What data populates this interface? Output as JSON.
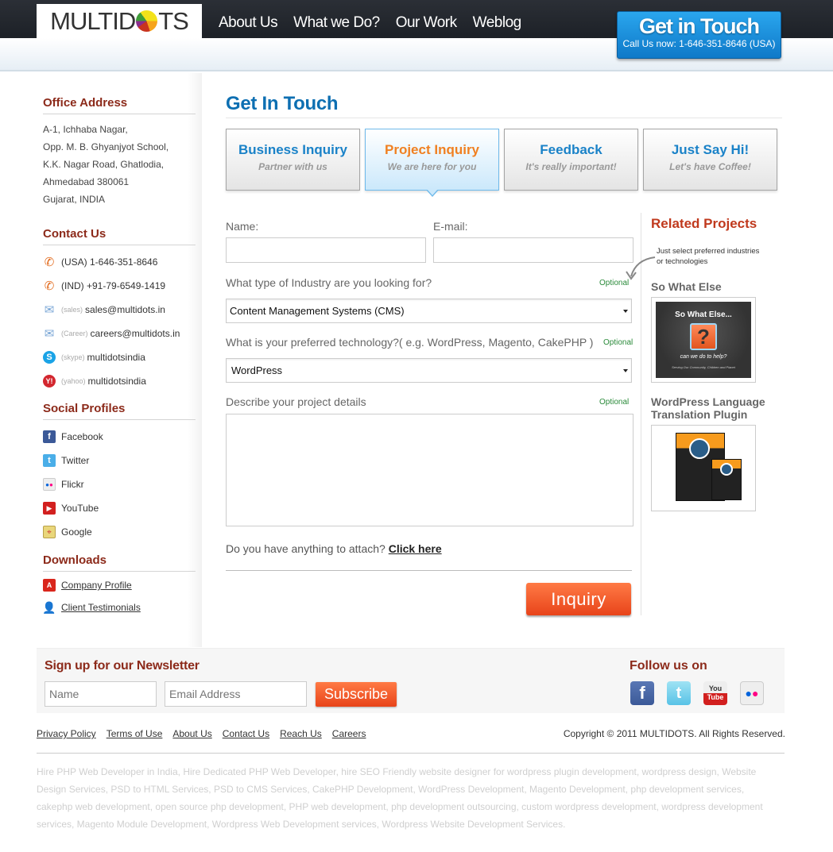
{
  "header": {
    "logo_text_left": "MULTID",
    "logo_text_right": "TS",
    "nav": [
      "About Us",
      "What we Do?",
      "Our Work",
      "Weblog"
    ],
    "cta_title": "Get in Touch",
    "cta_sub": "Call Us now: 1-646-351-8646 (USA)"
  },
  "sidebar": {
    "office": {
      "title": "Office Address",
      "lines": [
        "A-1, Ichhaba Nagar,",
        "Opp. M. B. Ghyanjyot School,",
        "K.K. Nagar Road, Ghatlodia,",
        "Ahmedabad 380061",
        "Gujarat, INDIA"
      ]
    },
    "contact": {
      "title": "Contact Us",
      "items": [
        {
          "icon": "phone-icon",
          "tag": "",
          "text": "(USA) 1-646-351-8646"
        },
        {
          "icon": "phone-icon",
          "tag": "",
          "text": "(IND) +91-79-6549-1419"
        },
        {
          "icon": "mail-icon",
          "tag": "(sales)",
          "text": "sales@multidots.in"
        },
        {
          "icon": "mail-icon",
          "tag": "(Career)",
          "text": "careers@multidots.in"
        },
        {
          "icon": "skype-icon",
          "tag": "(skype)",
          "text": "multidotsindia"
        },
        {
          "icon": "yahoo-icon",
          "tag": "(yahoo)",
          "text": "multidotsindia"
        }
      ]
    },
    "social": {
      "title": "Social Profiles",
      "items": [
        "Facebook",
        "Twitter",
        "Flickr",
        "YouTube",
        "Google"
      ]
    },
    "downloads": {
      "title": "Downloads",
      "items": [
        "Company Profile",
        "Client Testimonials"
      ]
    }
  },
  "main": {
    "title": "Get In Touch",
    "tabs": [
      {
        "title": "Business Inquiry",
        "sub": "Partner with us",
        "active": false
      },
      {
        "title": "Project Inquiry",
        "sub": "We are here for you",
        "active": true
      },
      {
        "title": "Feedback",
        "sub": "It's really important!",
        "active": false
      },
      {
        "title": "Just Say Hi!",
        "sub": "Let's have Coffee!",
        "active": false
      }
    ],
    "form": {
      "name_label": "Name:",
      "name_value": "",
      "email_label": "E-mail:",
      "email_value": "",
      "industry_label": "What type of Industry are you looking for?",
      "industry_value": "Content Management Systems (CMS)",
      "tech_label": "What is your preferred technology?( e.g. WordPress, Magento, CakePHP )",
      "tech_value": "WordPress",
      "details_label": "Describe your project details",
      "details_value": "",
      "optional": "Optional",
      "attach_text": "Do you have anything to attach?",
      "attach_link": "Click here",
      "submit": "Inquiry"
    }
  },
  "related": {
    "title": "Related Projects",
    "hint": "Just select preferred industries or technologies",
    "projects": [
      {
        "title": "So What Else",
        "img_title": "So What Else...",
        "img_q": "?",
        "img_sub": "can we do to help?",
        "img_foot": "Serving Our Community, Children and Planet"
      },
      {
        "title": "WordPress Language Translation Plugin"
      }
    ]
  },
  "newsletter": {
    "title": "Sign up for our Newsletter",
    "name_placeholder": "Name",
    "email_placeholder": "Email Address",
    "subscribe": "Subscribe",
    "follow_title": "Follow us on",
    "follow": [
      "facebook",
      "twitter",
      "youtube",
      "flickr"
    ]
  },
  "footer": {
    "links": [
      "Privacy Policy",
      "Terms of Use",
      "About Us",
      "Contact Us",
      "Reach Us",
      "Careers"
    ],
    "copyright": "Copyright © 2011 MULTIDOTS. All Rights Reserved.",
    "seo": "Hire PHP Web Developer in India, Hire Dedicated PHP Web Developer, hire SEO Friendly website designer for wordpress plugin development, wordpress design, Website Design Services, PSD to HTML Services, PSD to CMS Services, CakePHP Development, WordPress Development, Magento Development, php development services, cakephp web development, open source php development, PHP web development, php development outsourcing, custom wordpress development, wordpress development services, Magento Module Development, Wordpress Web Development services, Wordpress Website Development Services."
  }
}
